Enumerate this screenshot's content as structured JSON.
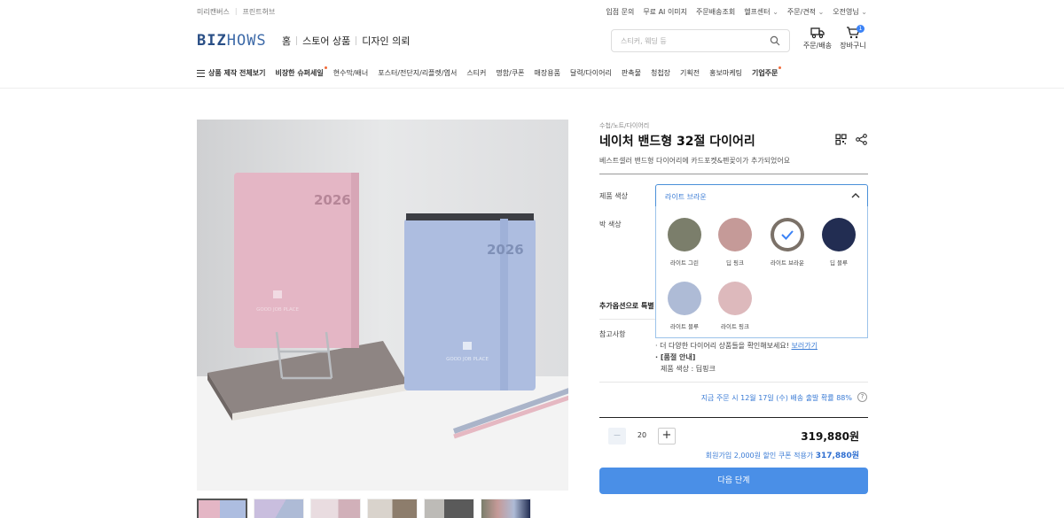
{
  "top_bar": {
    "left_links": [
      "미리캔버스",
      "프린트허브"
    ],
    "right_links": [
      {
        "label": "입점 문의",
        "dropdown": false
      },
      {
        "label": "무료 AI 이미지",
        "dropdown": false
      },
      {
        "label": "주문배송조회",
        "dropdown": false
      },
      {
        "label": "헬프센터",
        "dropdown": true
      },
      {
        "label": "주문/견적",
        "dropdown": true
      },
      {
        "label": "오전영님",
        "dropdown": true
      }
    ]
  },
  "header": {
    "logo_a": "BIZ",
    "logo_b": "HOWS",
    "nav": [
      "홈",
      "스토어 상품",
      "디자인 의뢰"
    ],
    "search_placeholder": "스티커, 웨딩 등",
    "order_label": "주문/배송",
    "cart_label": "장바구니",
    "cart_count": "1"
  },
  "categories": [
    {
      "label": "상품 제작 전체보기",
      "bold": true,
      "dot": false
    },
    {
      "label": "비장한 슈퍼세일",
      "bold": true,
      "dot": true
    },
    {
      "label": "현수막/배너",
      "bold": false,
      "dot": false
    },
    {
      "label": "포스터/전단지/리플렛/엽서",
      "bold": false,
      "dot": false
    },
    {
      "label": "스티커",
      "bold": false,
      "dot": false
    },
    {
      "label": "명함/쿠폰",
      "bold": false,
      "dot": false
    },
    {
      "label": "매장용품",
      "bold": false,
      "dot": false
    },
    {
      "label": "달력/다이어리",
      "bold": false,
      "dot": false
    },
    {
      "label": "판촉물",
      "bold": false,
      "dot": false
    },
    {
      "label": "청첩장",
      "bold": false,
      "dot": false
    },
    {
      "label": "기획전",
      "bold": false,
      "dot": false
    },
    {
      "label": "홍보마케팅",
      "bold": false,
      "dot": false
    },
    {
      "label": "기업주문",
      "bold": true,
      "dot": true
    }
  ],
  "product": {
    "breadcrumb": "수첩/노트/다이어리",
    "title": "네이처 밴드형 32절 다이어리",
    "subtitle": "베스트셀러 밴드형 다이어리에 카드포켓&펜꽂이가 추가되었어요",
    "cover_years": [
      "2026",
      "2026"
    ],
    "cover_brand": "GOOD JOB PLACE",
    "option_color_label": "제품 색상",
    "option_color_value": "라이트 브라운",
    "option_foil_label": "박 색상",
    "colors": [
      {
        "name": "라이트 그린",
        "hex": "#7b7e6b",
        "selected": false
      },
      {
        "name": "딥 핑크",
        "hex": "#c59a98",
        "selected": false
      },
      {
        "name": "라이트 브라운",
        "hex": "#7b7168",
        "selected": true
      },
      {
        "name": "딥 블루",
        "hex": "#222d52",
        "selected": false
      },
      {
        "name": "라이트 블루",
        "hex": "#aebbd6",
        "selected": false
      },
      {
        "name": "라이트 핑크",
        "hex": "#ddb9bc",
        "selected": false
      }
    ],
    "extra_options_label": "추가옵션으로 특별",
    "notes_label": "참고사항",
    "notes_line1": "· 더 다양한 다이어리 상품들을 확인해보세요!",
    "notes_link": "보러가기",
    "notes_line2": "· [품절 안내]",
    "notes_line3": "제품 색상 : 딥핑크",
    "shipping_info": "지금 주문 시 12월 17일 (수) 배송 출발 확률 88%",
    "help_mark": "?",
    "quantity": "20",
    "minus": "−",
    "plus": "+",
    "price": "319,880원",
    "member_text": "회원가입 2,000원 할인 쿠폰 적용가",
    "member_price": "317,880원",
    "next_button": "다음 단계"
  }
}
